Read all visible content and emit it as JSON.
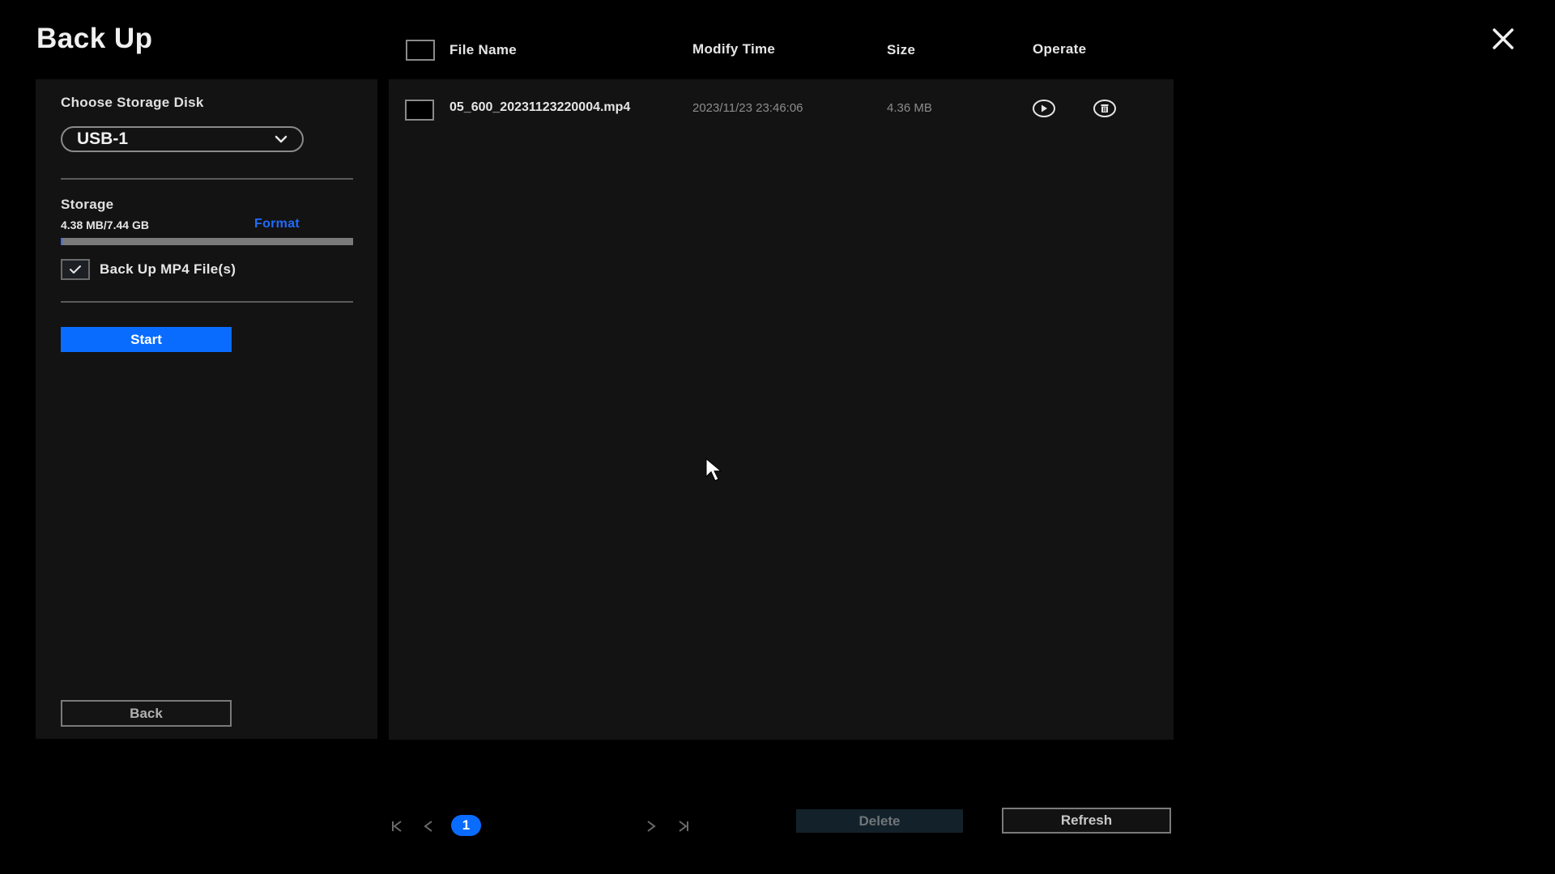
{
  "window": {
    "title": "Back Up",
    "close_icon": "close-icon"
  },
  "left_panel": {
    "disk_label": "Choose Storage Disk",
    "disk_selected": "USB-1",
    "storage_label": "Storage",
    "storage_value": "4.38 MB/7.44 GB",
    "storage_used_fraction": 0.0006,
    "format_label": "Format",
    "backup_mp4_label": "Back Up MP4 File(s)",
    "backup_mp4_checked": true,
    "start_label": "Start",
    "back_label": "Back"
  },
  "table": {
    "columns": {
      "file_name": "File Name",
      "modify_time": "Modify Time",
      "size": "Size",
      "operate": "Operate"
    },
    "rows": [
      {
        "file_name": "05_600_20231123220004.mp4",
        "modify_time": "2023/11/23 23:46:06",
        "size": "4.36 MB",
        "checked": false,
        "operations": [
          "play-icon",
          "delete-icon"
        ]
      }
    ]
  },
  "pagination": {
    "current_page": "1",
    "first_icon": "first-page-icon",
    "prev_icon": "prev-page-icon",
    "next_icon": "next-page-icon",
    "last_icon": "last-page-icon"
  },
  "footer": {
    "delete_label": "Delete",
    "refresh_label": "Refresh"
  },
  "colors": {
    "accent": "#0a6cff",
    "link": "#1f6bff",
    "panel_bg": "#131313",
    "background": "#000000"
  }
}
